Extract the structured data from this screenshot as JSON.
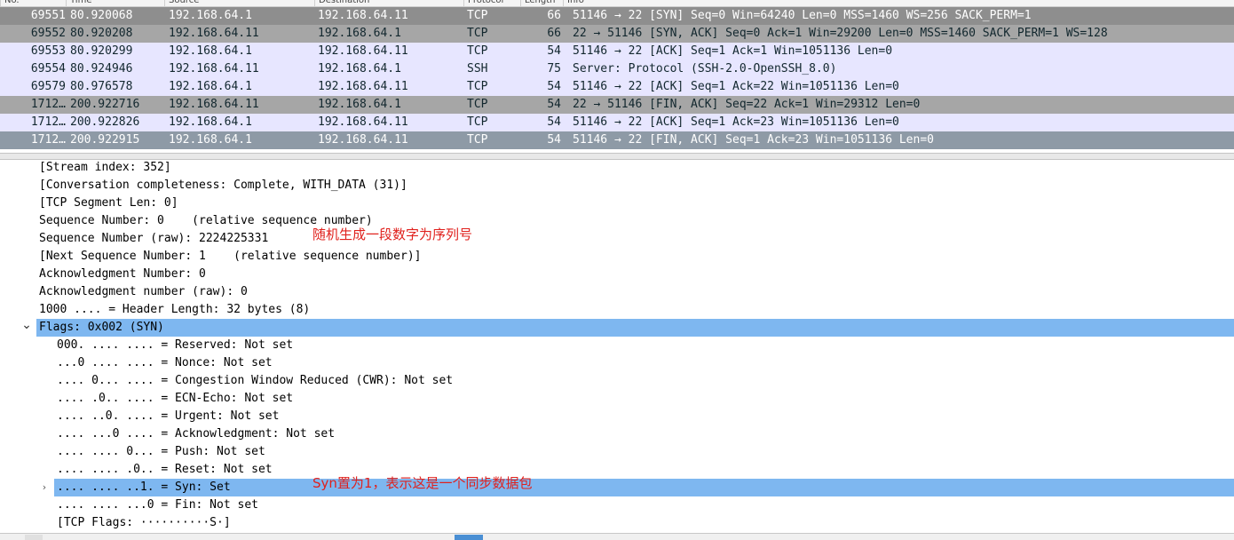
{
  "packet_list": {
    "columns": [
      "No.",
      "Time",
      "Source",
      "Destination",
      "Protocol",
      "Length",
      "Info"
    ],
    "rows": [
      {
        "no": "69551",
        "time": "80.920068",
        "src": "192.168.64.1",
        "dst": "192.168.64.11",
        "proto": "TCP",
        "len": "66",
        "info": "51146 → 22 [SYN] Seq=0 Win=64240 Len=0 MSS=1460 WS=256 SACK_PERM=1",
        "bg": "#8e8e8e",
        "fg": "#ffffff"
      },
      {
        "no": "69552",
        "time": "80.920208",
        "src": "192.168.64.11",
        "dst": "192.168.64.1",
        "proto": "TCP",
        "len": "66",
        "info": "22 → 51146 [SYN, ACK] Seq=0 Ack=1 Win=29200 Len=0 MSS=1460 SACK_PERM=1 WS=128",
        "bg": "#a6a6a6",
        "fg": "#12272e"
      },
      {
        "no": "69553",
        "time": "80.920299",
        "src": "192.168.64.1",
        "dst": "192.168.64.11",
        "proto": "TCP",
        "len": "54",
        "info": "51146 → 22 [ACK] Seq=1 Ack=1 Win=1051136 Len=0",
        "bg": "#e7e6ff",
        "fg": "#12272e"
      },
      {
        "no": "69554",
        "time": "80.924946",
        "src": "192.168.64.11",
        "dst": "192.168.64.1",
        "proto": "SSH",
        "len": "75",
        "info": "Server: Protocol (SSH-2.0-OpenSSH_8.0)",
        "bg": "#e7e6ff",
        "fg": "#12272e"
      },
      {
        "no": "69579",
        "time": "80.976578",
        "src": "192.168.64.1",
        "dst": "192.168.64.11",
        "proto": "TCP",
        "len": "54",
        "info": "51146 → 22 [ACK] Seq=1 Ack=22 Win=1051136 Len=0",
        "bg": "#e7e6ff",
        "fg": "#12272e"
      },
      {
        "no": "1712…",
        "time": "200.922716",
        "src": "192.168.64.11",
        "dst": "192.168.64.1",
        "proto": "TCP",
        "len": "54",
        "info": "22 → 51146 [FIN, ACK] Seq=22 Ack=1 Win=29312 Len=0",
        "bg": "#a6a6a6",
        "fg": "#12272e"
      },
      {
        "no": "1712…",
        "time": "200.922826",
        "src": "192.168.64.1",
        "dst": "192.168.64.11",
        "proto": "TCP",
        "len": "54",
        "info": "51146 → 22 [ACK] Seq=1 Ack=23 Win=1051136 Len=0",
        "bg": "#e7e6ff",
        "fg": "#12272e"
      },
      {
        "no": "1712…",
        "time": "200.922915",
        "src": "192.168.64.1",
        "dst": "192.168.64.11",
        "proto": "TCP",
        "len": "54",
        "info": "51146 → 22 [FIN, ACK] Seq=1 Ack=23 Win=1051136 Len=0",
        "bg": "#8e9aa6",
        "fg": "#ffffff"
      }
    ]
  },
  "details": {
    "lines": [
      {
        "text": "[Stream index: 352]",
        "indent": 0,
        "toggle": "",
        "selected": false
      },
      {
        "text": "[Conversation completeness: Complete, WITH_DATA (31)]",
        "indent": 0,
        "toggle": "",
        "selected": false
      },
      {
        "text": "[TCP Segment Len: 0]",
        "indent": 0,
        "toggle": "",
        "selected": false
      },
      {
        "text": "Sequence Number: 0    (relative sequence number)",
        "indent": 0,
        "toggle": "",
        "selected": false
      },
      {
        "text": "Sequence Number (raw): 2224225331",
        "indent": 0,
        "toggle": "",
        "selected": false
      },
      {
        "text": "[Next Sequence Number: 1    (relative sequence number)]",
        "indent": 0,
        "toggle": "",
        "selected": false
      },
      {
        "text": "Acknowledgment Number: 0",
        "indent": 0,
        "toggle": "",
        "selected": false
      },
      {
        "text": "Acknowledgment number (raw): 0",
        "indent": 0,
        "toggle": "",
        "selected": false
      },
      {
        "text": "1000 .... = Header Length: 32 bytes (8)",
        "indent": 0,
        "toggle": "",
        "selected": false
      },
      {
        "text": "Flags: 0x002 (SYN)",
        "indent": 0,
        "toggle": "expanded",
        "selected": true
      },
      {
        "text": "000. .... .... = Reserved: Not set",
        "indent": 1,
        "toggle": "",
        "selected": false
      },
      {
        "text": "...0 .... .... = Nonce: Not set",
        "indent": 1,
        "toggle": "",
        "selected": false
      },
      {
        "text": ".... 0... .... = Congestion Window Reduced (CWR): Not set",
        "indent": 1,
        "toggle": "",
        "selected": false
      },
      {
        "text": ".... .0.. .... = ECN-Echo: Not set",
        "indent": 1,
        "toggle": "",
        "selected": false
      },
      {
        "text": ".... ..0. .... = Urgent: Not set",
        "indent": 1,
        "toggle": "",
        "selected": false
      },
      {
        "text": ".... ...0 .... = Acknowledgment: Not set",
        "indent": 1,
        "toggle": "",
        "selected": false
      },
      {
        "text": ".... .... 0... = Push: Not set",
        "indent": 1,
        "toggle": "",
        "selected": false
      },
      {
        "text": ".... .... .0.. = Reset: Not set",
        "indent": 1,
        "toggle": "",
        "selected": false
      },
      {
        "text": ".... .... ..1. = Syn: Set",
        "indent": 1,
        "toggle": "collapsed",
        "selected": true
      },
      {
        "text": ".... .... ...0 = Fin: Not set",
        "indent": 1,
        "toggle": "",
        "selected": false
      },
      {
        "text": "[TCP Flags: ··········S·]",
        "indent": 1,
        "toggle": "",
        "selected": false
      }
    ],
    "annotations": [
      {
        "text": "随机生成一段数字为序列号",
        "line": 4
      },
      {
        "text": "Syn置为1，表示这是一个同步数据包",
        "line": 18
      }
    ]
  },
  "icons": {
    "expanded": "chevron-down-icon",
    "collapsed": "chevron-right-icon"
  },
  "colors": {
    "selection": "#7eb7f0",
    "annotation": "#e0211d",
    "bottom_tab": "#4a8fd4"
  }
}
